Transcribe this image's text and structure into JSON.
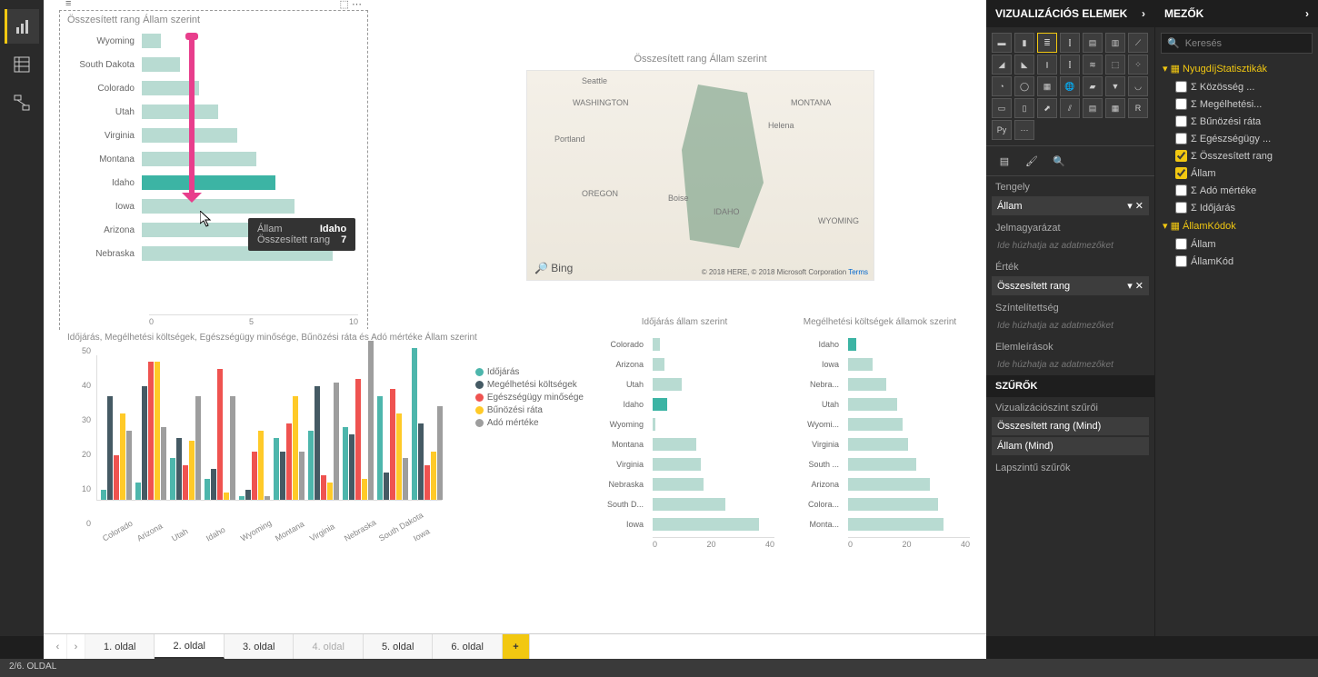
{
  "left_rail": {
    "items": [
      "report",
      "data",
      "model"
    ],
    "active": 0
  },
  "status_bar": "2/6. OLDAL",
  "page_tabs": {
    "items": [
      "1. oldal",
      "2. oldal",
      "3. oldal",
      "4. oldal",
      "5. oldal",
      "6. oldal"
    ],
    "active": 1,
    "muted": [
      3
    ]
  },
  "viz_panel": {
    "title": "VIZUALIZÁCIÓS ELEMEK",
    "wells": {
      "axis_label": "Tengely",
      "axis_value": "Állam",
      "legend_label": "Jelmagyarázat",
      "legend_placeholder": "Ide húzhatja az adatmezőket",
      "value_label": "Érték",
      "value_value": "Összesített rang",
      "sat_label": "Színtelítettség",
      "sat_placeholder": "Ide húzhatja az adatmezőket",
      "tooltip_label": "Elemleírások",
      "tooltip_placeholder": "Ide húzhatja az adatmezőket"
    },
    "filters": {
      "header": "SZŰRŐK",
      "visual_label": "Vizualizációszint szűrői",
      "items": [
        "Összesített rang (Mind)",
        "Állam (Mind)"
      ],
      "page_label": "Lapszintű szűrők"
    }
  },
  "fields_panel": {
    "title": "MEZŐK",
    "search_placeholder": "Keresés",
    "tables": [
      {
        "name": "NyugdíjStatisztikák",
        "fields": [
          {
            "label": "Közösség ...",
            "checked": false,
            "sigma": true
          },
          {
            "label": "Megélhetési...",
            "checked": false,
            "sigma": true
          },
          {
            "label": "Bűnözési ráta",
            "checked": false,
            "sigma": true
          },
          {
            "label": "Egészségügy ...",
            "checked": false,
            "sigma": true
          },
          {
            "label": "Összesített rang",
            "checked": true,
            "sigma": true
          },
          {
            "label": "Állam",
            "checked": true,
            "sigma": false
          },
          {
            "label": "Adó mértéke",
            "checked": false,
            "sigma": true
          },
          {
            "label": "Időjárás",
            "checked": false,
            "sigma": true
          }
        ]
      },
      {
        "name": "ÁllamKódok",
        "fields": [
          {
            "label": "Állam",
            "checked": false,
            "sigma": false
          },
          {
            "label": "ÁllamKód",
            "checked": false,
            "sigma": false
          }
        ]
      }
    ]
  },
  "tooltip": {
    "k1": "Állam",
    "v1": "Idaho",
    "k2": "Összesített rang",
    "v2": "7"
  },
  "map": {
    "title": "Összesített rang Állam szerint",
    "labels": [
      "Seattle",
      "WASHINGTON",
      "MONTANA",
      "Portland",
      "Helena",
      "OREGON",
      "Boise",
      "IDAHO",
      "WYOMING"
    ],
    "bing": "Bing",
    "credit": "© 2018 HERE, © 2018 Microsoft Corporation",
    "terms": "Terms"
  },
  "chart_data": [
    {
      "id": "rank",
      "type": "bar",
      "orientation": "h",
      "title": "Összesített rang Állam szerint",
      "categories": [
        "Wyoming",
        "South Dakota",
        "Colorado",
        "Utah",
        "Virginia",
        "Montana",
        "Idaho",
        "Iowa",
        "Arizona",
        "Nebraska"
      ],
      "values": [
        1,
        2,
        3,
        4,
        5,
        6,
        7,
        8,
        9,
        10
      ],
      "highlight": "Idaho",
      "xticks": [
        0,
        5,
        10
      ],
      "xlim": [
        0,
        10
      ]
    },
    {
      "id": "multi",
      "type": "bar-grouped",
      "title": "Időjárás, Megélhetési költségek, Egészségügy minősége, Bűnözési ráta és Adó mértéke Állam szerint",
      "categories": [
        "Colorado",
        "Arizona",
        "Utah",
        "Idaho",
        "Wyoming",
        "Montana",
        "Virginia",
        "Nebraska",
        "South Dakota",
        "Iowa"
      ],
      "series": [
        {
          "name": "Időjárás",
          "color": "#4db6ac",
          "values": [
            3,
            5,
            12,
            6,
            1,
            18,
            20,
            21,
            30,
            44
          ]
        },
        {
          "name": "Megélhetési költségek",
          "color": "#455a64",
          "values": [
            30,
            33,
            18,
            9,
            3,
            14,
            33,
            19,
            8,
            22
          ]
        },
        {
          "name": "Egészségügy minősége",
          "color": "#ef5350",
          "values": [
            13,
            40,
            10,
            38,
            14,
            22,
            7,
            35,
            32,
            10
          ]
        },
        {
          "name": "Bűnözési ráta",
          "color": "#ffca28",
          "values": [
            25,
            40,
            17,
            2,
            20,
            30,
            5,
            6,
            25,
            14
          ]
        },
        {
          "name": "Adó mértéke",
          "color": "#9e9e9e",
          "values": [
            20,
            21,
            30,
            30,
            1,
            14,
            34,
            46,
            12,
            27
          ]
        }
      ],
      "yticks": [
        0,
        10,
        20,
        30,
        40,
        50
      ],
      "ylim": [
        0,
        50
      ]
    },
    {
      "id": "weather",
      "type": "bar",
      "orientation": "h",
      "title": "Időjárás állam szerint",
      "categories": [
        "Colorado",
        "Arizona",
        "Utah",
        "Idaho",
        "Wyoming",
        "Montana",
        "Virginia",
        "Nebraska",
        "South D...",
        "Iowa"
      ],
      "values": [
        3,
        5,
        12,
        6,
        1,
        18,
        20,
        21,
        30,
        44
      ],
      "highlight": "Idaho",
      "xticks": [
        0,
        20,
        40
      ],
      "xlim": [
        0,
        45
      ]
    },
    {
      "id": "cost",
      "type": "bar",
      "orientation": "h",
      "title": "Megélhetési költségek államok szerint",
      "categories": [
        "Idaho",
        "Iowa",
        "Nebra...",
        "Utah",
        "Wyomi...",
        "Virginia",
        "South ...",
        "Arizona",
        "Colora...",
        "Monta..."
      ],
      "values": [
        3,
        9,
        14,
        18,
        20,
        22,
        25,
        30,
        33,
        35
      ],
      "highlight": "Idaho",
      "xticks": [
        0,
        20,
        40
      ],
      "xlim": [
        0,
        40
      ]
    }
  ]
}
